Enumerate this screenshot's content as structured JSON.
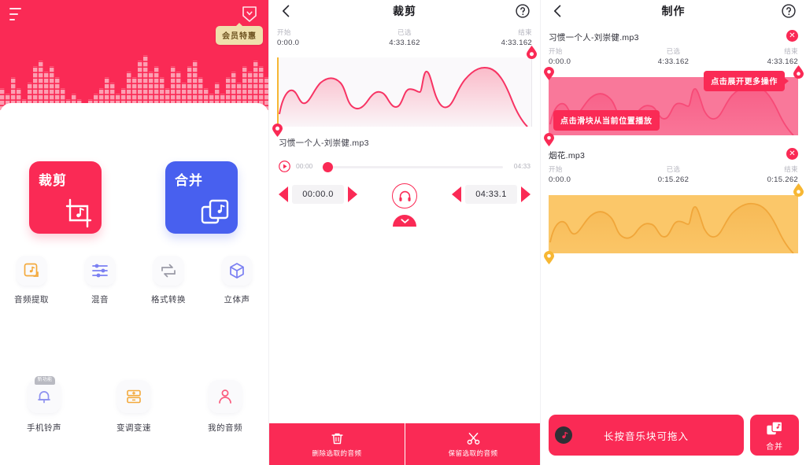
{
  "home": {
    "menu_icon": "hamburger-icon",
    "vip_icon": "heart-shield-icon",
    "vip_badge": "会员特惠",
    "big_cards": [
      {
        "title": "裁剪",
        "icon": "crop-music-icon",
        "color": "#fa2a55"
      },
      {
        "title": "合并",
        "icon": "merge-copies-icon",
        "color": "#4860ef"
      }
    ],
    "tools": [
      {
        "label": "音频提取",
        "icon": "audio-extract-icon",
        "color": "#f3a93c"
      },
      {
        "label": "混音",
        "icon": "mixer-sliders-icon",
        "color": "#7b80f2"
      },
      {
        "label": "格式转换",
        "icon": "format-convert-icon",
        "color": "#9a9aa6"
      },
      {
        "label": "立体声",
        "icon": "stereo-cube-icon",
        "color": "#7b80f2"
      }
    ],
    "shortcuts": [
      {
        "label": "手机铃声",
        "icon": "bell-icon",
        "color": "#8f92f0",
        "badge": "新功能"
      },
      {
        "label": "变调变速",
        "icon": "pitch-speed-icon",
        "color": "#f3a93c",
        "badge": ""
      },
      {
        "label": "我的音频",
        "icon": "user-icon",
        "color": "#fa5c7e",
        "badge": ""
      }
    ]
  },
  "trim": {
    "back_icon": "chevron-left-icon",
    "title": "裁剪",
    "help_icon": "question-circle-icon",
    "times": {
      "start_label": "开始",
      "start_value": "0:00.0",
      "selected_label": "已选",
      "selected_value": "4:33.162",
      "end_label": "结束",
      "end_value": "4:33.162"
    },
    "filename": "习惯一个人-刘崇健.mp3",
    "seek": {
      "play_icon": "play-circle-icon",
      "current": "00:00",
      "total": "04:33",
      "progress_percent": 0
    },
    "start_stepper": {
      "dec_icon": "arrow-left-icon",
      "value": "00:00.0",
      "inc_icon": "arrow-right-icon"
    },
    "end_stepper": {
      "dec_icon": "arrow-left-icon",
      "value": "04:33.1",
      "inc_icon": "arrow-right-icon"
    },
    "headphone_icon": "headphone-circle-icon",
    "collapse_icon": "chevron-down-icon",
    "actions": [
      {
        "label": "删除选取的音频",
        "icon": "trash-icon"
      },
      {
        "label": "保留选取的音频",
        "icon": "scissors-icon"
      }
    ]
  },
  "make": {
    "back_icon": "chevron-left-icon",
    "title": "制作",
    "help_icon": "question-circle-icon",
    "tooltips": {
      "more_actions": "点击展开更多操作",
      "slide_to_play": "点击滑块从当前位置播放"
    },
    "tracks": [
      {
        "name": "习惯一个人-刘崇健.mp3",
        "close_icon": "close-circle-icon",
        "start_label": "开始",
        "start_value": "0:00.0",
        "selected_label": "已选",
        "selected_value": "4:33.162",
        "end_label": "结束",
        "end_value": "4:33.162",
        "color": "#f9789a"
      },
      {
        "name": "烟花.mp3",
        "close_icon": "close-circle-icon",
        "start_label": "开始",
        "start_value": "0:00.0",
        "selected_label": "已选",
        "selected_value": "0:15.262",
        "end_label": "结束",
        "end_value": "0:15.262",
        "color": "#fbc769"
      }
    ],
    "drag_hint": "长按音乐块可拖入",
    "drag_icon": "vinyl-disc-icon",
    "merge_label": "合并",
    "merge_icon": "merge-copies-icon"
  },
  "colors": {
    "primary": "#fa2a55",
    "blue": "#4860ef",
    "orange": "#fbc769",
    "pink_block": "#f9789a",
    "badge_bg": "#efdfac"
  }
}
